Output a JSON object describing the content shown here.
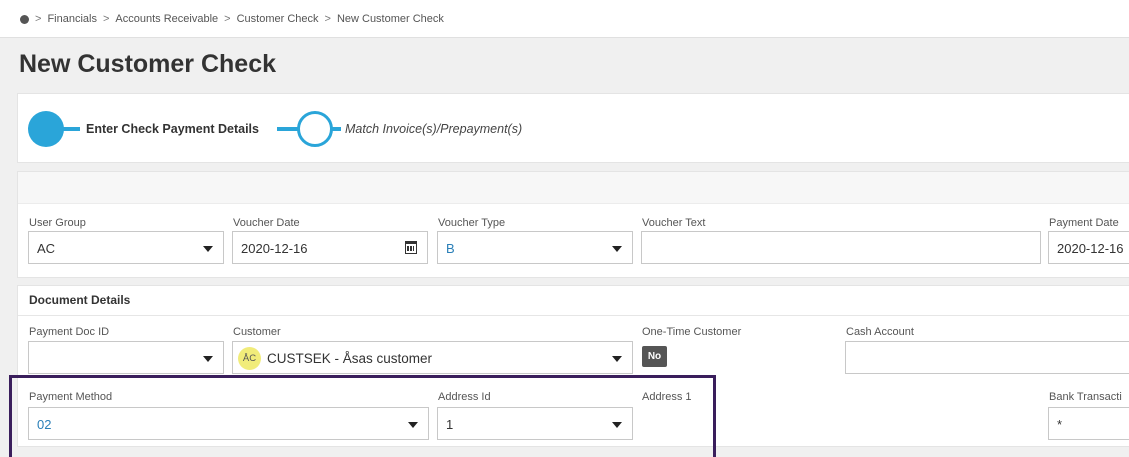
{
  "breadcrumb": {
    "items": [
      "Financials",
      "Accounts Receivable",
      "Customer Check",
      "New Customer Check"
    ],
    "separator": ">"
  },
  "page": {
    "title": "New Customer Check"
  },
  "steps": {
    "step1": "Enter Check Payment Details",
    "step2": "Match Invoice(s)/Prepayment(s)",
    "accent_color": "#2aa5d9"
  },
  "header_fields": {
    "user_group": {
      "label": "User Group",
      "value": "AC"
    },
    "voucher_date": {
      "label": "Voucher Date",
      "value": "2020-12-16"
    },
    "voucher_type": {
      "label": "Voucher Type",
      "value": "B"
    },
    "voucher_text": {
      "label": "Voucher Text",
      "value": ""
    },
    "payment_date": {
      "label": "Payment Date",
      "value": "2020-12-16"
    }
  },
  "document_details": {
    "title": "Document Details",
    "payment_doc_id": {
      "label": "Payment Doc ID",
      "value": ""
    },
    "customer": {
      "label": "Customer",
      "avatar": "ÅC",
      "value": "CUSTSEK - Åsas customer"
    },
    "one_time_customer": {
      "label": "One-Time Customer",
      "value": "No"
    },
    "cash_account": {
      "label": "Cash Account",
      "value": ""
    },
    "payment_method": {
      "label": "Payment Method",
      "value": "02"
    },
    "address_id": {
      "label": "Address Id",
      "value": "1"
    },
    "address1": {
      "label": "Address 1"
    },
    "bank_transaction": {
      "label": "Bank Transacti",
      "value": "*"
    }
  },
  "highlight_color": "#3a1e5c"
}
